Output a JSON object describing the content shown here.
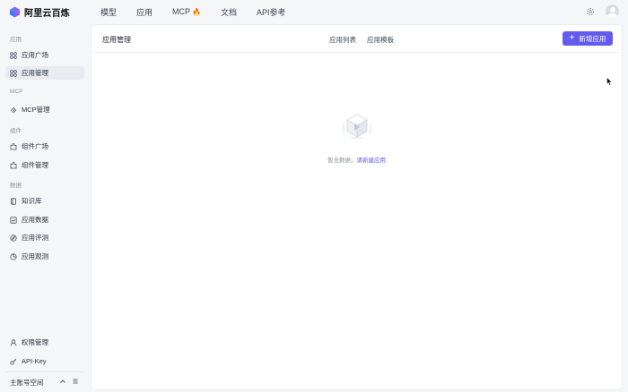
{
  "brand": {
    "name": "阿里云百炼",
    "logo_icon": "bailian-cube-logo"
  },
  "topnav": [
    {
      "label": "模型"
    },
    {
      "label": "应用"
    },
    {
      "label": "MCP",
      "badge_icon": "fire-icon"
    },
    {
      "label": "文档"
    },
    {
      "label": "API参考"
    }
  ],
  "header_icons": {
    "settings": "gear-icon",
    "user": "avatar-icon"
  },
  "sidebar": {
    "sections": [
      {
        "label": "应用",
        "items": [
          {
            "label": "应用广场",
            "icon": "grid-icon"
          },
          {
            "label": "应用管理",
            "icon": "grid-icon",
            "active": true
          }
        ]
      },
      {
        "label": "MCP",
        "items": [
          {
            "label": "MCP管理",
            "icon": "mcp-icon"
          }
        ]
      },
      {
        "label": "组件",
        "items": [
          {
            "label": "组件广场",
            "icon": "plugin-icon"
          },
          {
            "label": "组件管理",
            "icon": "plugin-icon"
          }
        ]
      },
      {
        "label": "数据",
        "items": [
          {
            "label": "知识库",
            "icon": "book-icon"
          },
          {
            "label": "应用数据",
            "icon": "chart-icon"
          },
          {
            "label": "应用评测",
            "icon": "compass-icon"
          },
          {
            "label": "应用观测",
            "icon": "pie-icon"
          }
        ]
      }
    ],
    "bottom_items": [
      {
        "label": "权限管理",
        "icon": "user-icon"
      },
      {
        "label": "API-Key",
        "icon": "key-icon"
      }
    ],
    "account": {
      "label": "主账号空间"
    }
  },
  "main": {
    "title": "应用管理",
    "tabs": [
      "应用列表",
      "应用模板"
    ],
    "create_button": "新增应用",
    "empty_text": "暂无数据，",
    "empty_link": "请新建应用"
  },
  "colors": {
    "accent": "#615ced",
    "panel": "#ffffff",
    "background": "#f5f6f8"
  }
}
